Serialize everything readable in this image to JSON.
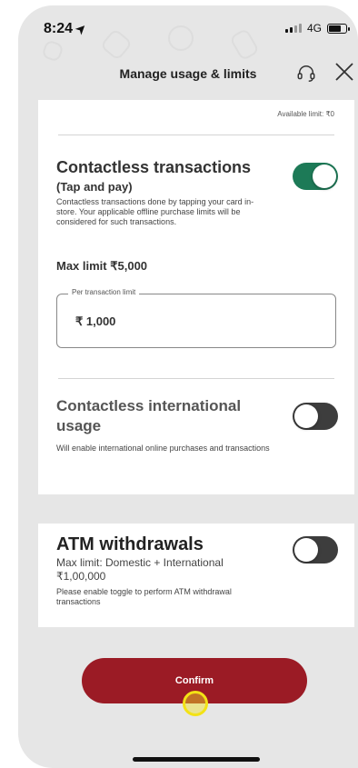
{
  "status_bar": {
    "time": "8:24",
    "network": "4G"
  },
  "header": {
    "title": "Manage usage & limits",
    "support_icon": "headset-icon",
    "close_icon": "close-icon"
  },
  "contactless": {
    "available_limit": "Available limit: ₹0",
    "title": "Contactless transactions",
    "subtitle": "(Tap and pay)",
    "description": "Contactless transactions done by tapping your card in-store. Your applicable offline purchase limits will be considered for such transactions.",
    "max_limit": "Max limit ₹5,000",
    "field_label": "Per transaction limit",
    "field_value": "₹ 1,000",
    "enabled": true
  },
  "international": {
    "title": "Contactless international usage",
    "description": "Will enable international online purchases and transactions",
    "enabled": false
  },
  "atm": {
    "title": "ATM withdrawals",
    "max_limit": "Max limit: Domestic + International ₹1,00,000",
    "description": "Please enable toggle to perform ATM withdrawal transactions",
    "enabled": false
  },
  "confirm_label": "Confirm",
  "colors": {
    "brand_red": "#9b1b25",
    "toggle_on": "#1d7a57",
    "toggle_off": "#3d3d3d",
    "tap_marker": "#f3e215"
  }
}
